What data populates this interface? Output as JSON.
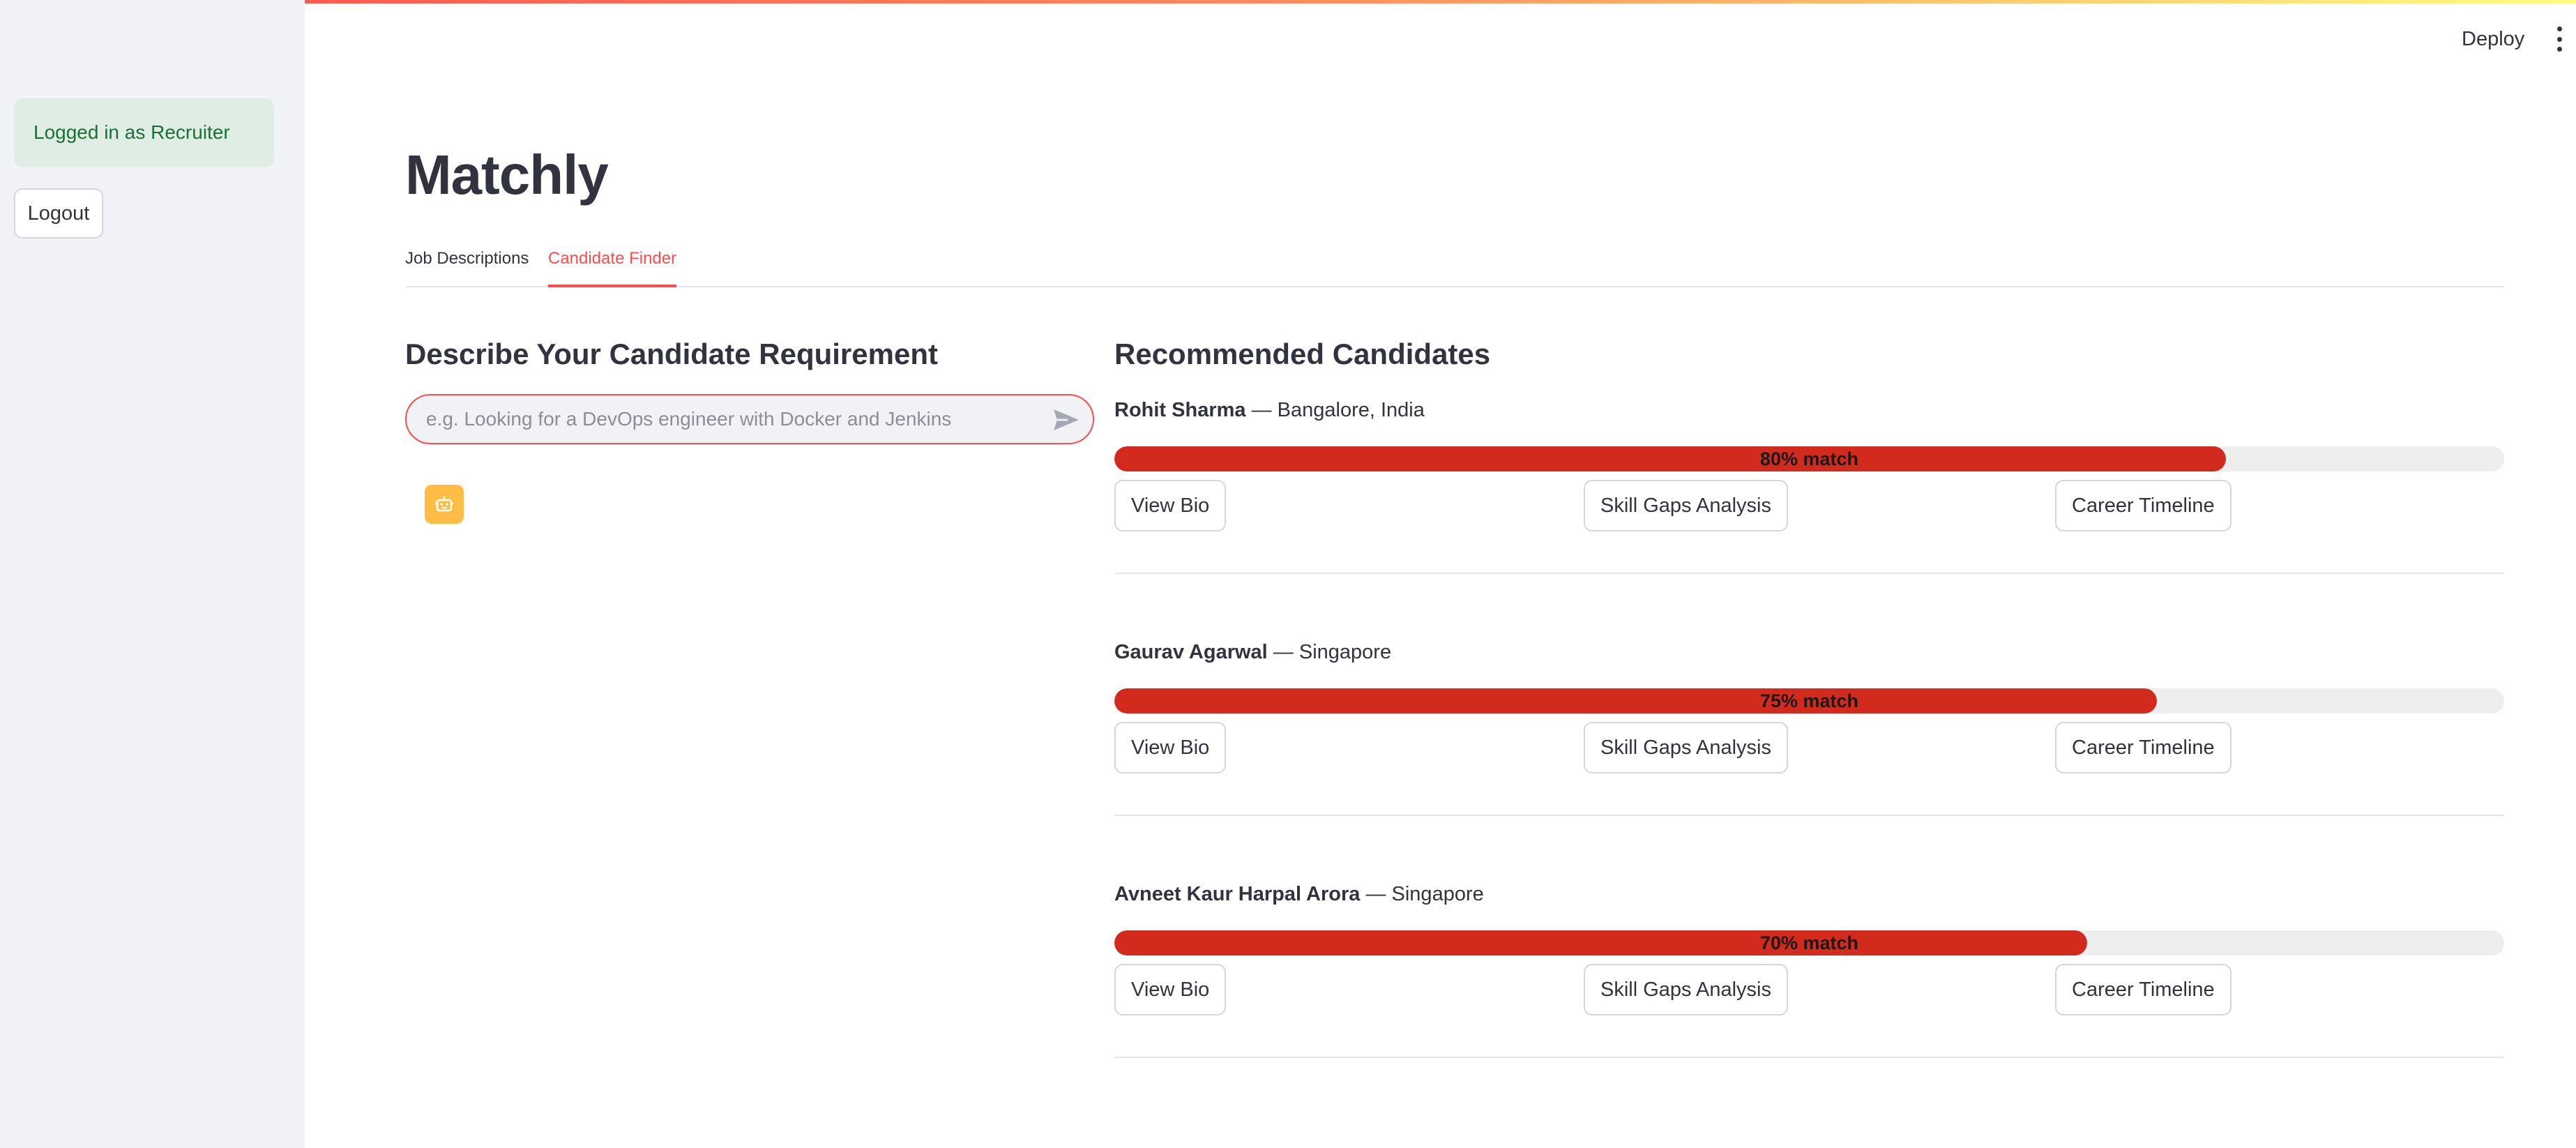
{
  "header": {
    "deploy_label": "Deploy"
  },
  "sidebar": {
    "login_status": "Logged in as Recruiter",
    "logout_label": "Logout"
  },
  "app": {
    "title": "Matchly"
  },
  "tabs": [
    {
      "label": "Job Descriptions",
      "active": false
    },
    {
      "label": "Candidate Finder",
      "active": true
    }
  ],
  "requirement": {
    "heading": "Describe Your Candidate Requirement",
    "input_value": "",
    "placeholder": "e.g. Looking for a DevOps engineer with Docker and Jenkins"
  },
  "recommended": {
    "heading": "Recommended Candidates",
    "candidates": [
      {
        "name": "Rohit Sharma",
        "location": " — Bangalore, India",
        "match_percent": 80,
        "match_label": "80% match"
      },
      {
        "name": "Gaurav Agarwal",
        "location": " — Singapore",
        "match_percent": 75,
        "match_label": "75% match"
      },
      {
        "name": "Avneet Kaur Harpal Arora",
        "location": " — Singapore",
        "match_percent": 70,
        "match_label": "70% match"
      }
    ],
    "actions": {
      "view_bio": "View Bio",
      "skill_gaps": "Skill Gaps Analysis",
      "career_timeline": "Career Timeline"
    }
  },
  "colors": {
    "accent": "#ff4b4b",
    "match_fill": "#d32a1e",
    "success_bg": "#dfede5",
    "success_text": "#177233",
    "bot_avatar": "#ffbd45"
  },
  "icons": {
    "send": "send-icon",
    "bot": "robot-icon",
    "menu": "more-vertical-icon"
  }
}
